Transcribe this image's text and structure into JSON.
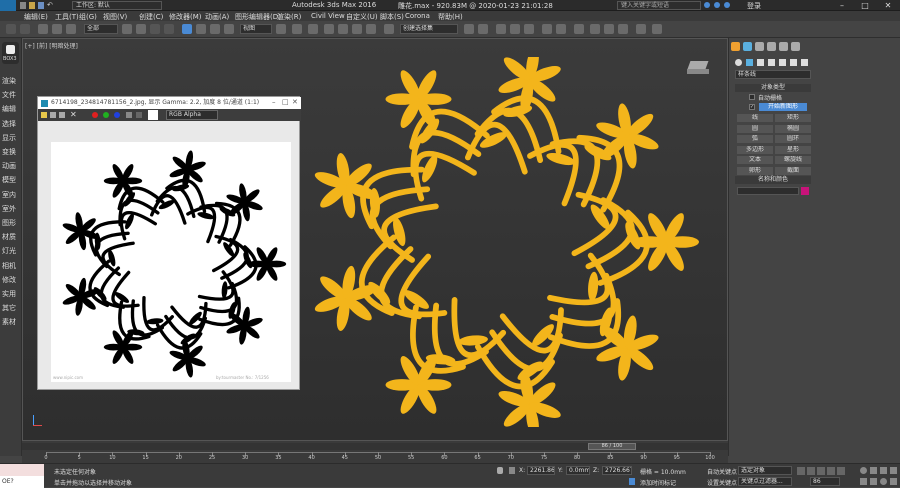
{
  "window": {
    "app_title": "Autodesk 3ds Max 2016",
    "file_info": "雕花.max - 920.83M @ 2020-01-23 21:01:28",
    "workspace_label": "工作区: 默认",
    "search_placeholder": "键入关键字或短语",
    "login_label": "登录",
    "app_logo": "MAX"
  },
  "menu": [
    "编辑(E)",
    "工具(T)",
    "组(G)",
    "视图(V)",
    "创建(C)",
    "修改器(M)",
    "动画(A)",
    "图形编辑器(D)",
    "渲染(R)",
    "Civil View",
    "自定义(U)",
    "脚本(S)",
    "Corona",
    "帮助(H)"
  ],
  "toolbar": {
    "selection_filter": "全部",
    "reference_coord": "视图",
    "named_selection": "创建选择集"
  },
  "left_sidebar": {
    "logo": "BOX3",
    "items": [
      "渲染",
      "文件",
      "编辑",
      "选择",
      "显示",
      "变换",
      "动画",
      "模型",
      "室内",
      "室外",
      "图形",
      "材质",
      "灯光",
      "相机",
      "修改",
      "实用",
      "其它",
      "素材"
    ]
  },
  "viewport": {
    "label": "[+] [前] [明暗处理]"
  },
  "frame_window": {
    "title": "6714198_234814781156_2.jpg, 显示 Gamma: 2.2, 加度 8 位/通道 (1:1)",
    "channel_select": "RGB Alpha",
    "watermark_left": "www.nipic.com",
    "watermark_right": "by:tourmaster  No.: 7/1256"
  },
  "command_panel": {
    "dropdown": "样条线",
    "object_type_header": "对象类型",
    "autogrid": "自动栅格",
    "start_new_shape": "开始新图形",
    "buttons": [
      "线",
      "矩形",
      "圆",
      "椭圆",
      "弧",
      "圆环",
      "多边形",
      "星形",
      "文本",
      "螺旋线",
      "卵形",
      "截面"
    ],
    "name_color_header": "名称和颜色"
  },
  "timeline": {
    "frame_counter": "86 / 100",
    "ticks": [
      "0",
      "5",
      "10",
      "15",
      "20",
      "25",
      "30",
      "35",
      "40",
      "45",
      "50",
      "55",
      "60",
      "65",
      "70",
      "75",
      "80",
      "85",
      "90",
      "95",
      "100"
    ]
  },
  "status": {
    "maxscript_label": "OE?",
    "selection_info": "未选定任何对象",
    "prompt": "单击并拖动以选择并移动对象",
    "x_label": "X:",
    "x_value": "2261.868m",
    "y_label": "Y:",
    "y_value": "0.0mm",
    "z_label": "Z:",
    "z_value": "2726.667m",
    "grid_label": "栅格 = 10.0mm",
    "add_time_tag": "添加时间标记",
    "auto_key": "自动关键点",
    "set_key": "设置关键点",
    "key_filter": "选定对象",
    "key_filters_btn": "关键点过滤器...",
    "frame_field": "86"
  },
  "colors": {
    "flower_orange": "#f3b51b",
    "accent_blue": "#4a8ad4",
    "object_color": "#c8137a"
  }
}
